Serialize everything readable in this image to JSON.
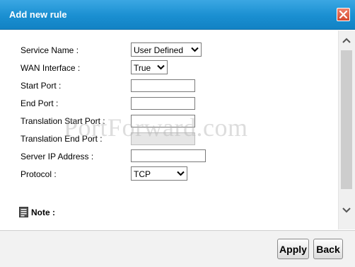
{
  "dialog": {
    "title": "Add new rule",
    "close_icon": "close-icon"
  },
  "form": {
    "service_name": {
      "label": "Service Name :",
      "value": "User Defined"
    },
    "wan_interface": {
      "label": "WAN Interface :",
      "value": "True"
    },
    "start_port": {
      "label": "Start Port :",
      "value": ""
    },
    "end_port": {
      "label": "End Port :",
      "value": ""
    },
    "translation_start_port": {
      "label": "Translation Start Port :",
      "value": ""
    },
    "translation_end_port": {
      "label": "Translation End Port :",
      "value": "",
      "disabled": true
    },
    "server_ip_address": {
      "label": "Server IP Address :",
      "value": ""
    },
    "protocol": {
      "label": "Protocol :",
      "value": "TCP"
    }
  },
  "watermark": "PortForward.com",
  "note": {
    "label": "Note :",
    "icon": "document-icon"
  },
  "footer": {
    "apply_label": "Apply",
    "back_label": "Back"
  }
}
